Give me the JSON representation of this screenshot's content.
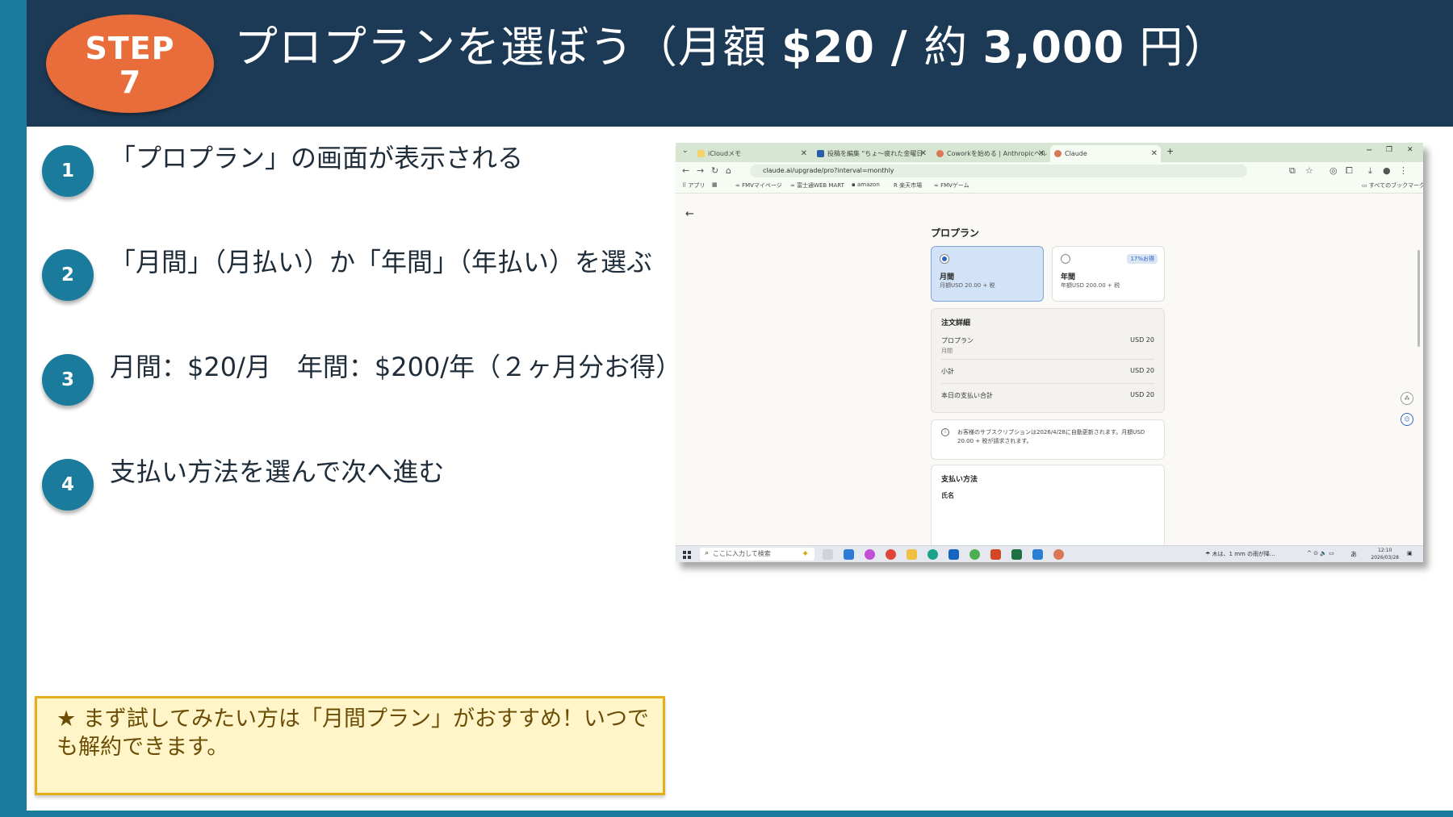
{
  "header": {
    "step_label": "STEP",
    "step_number": "7",
    "title_prefix": "プロプランを選ぼう（月額 ",
    "title_price_usd": "$20 / ",
    "title_approx": "約",
    "title_price_jpy": "3,000",
    "title_suffix": "円）"
  },
  "steps": [
    {
      "number": "1",
      "text": "「プロプラン」の画面が表示される"
    },
    {
      "number": "2",
      "text": "「月間」（月払い）か「年間」（年払い）を選ぶ"
    },
    {
      "number": "3",
      "text": "月間：$20/月　年間：$200/年（２ヶ月分お得）"
    },
    {
      "number": "4",
      "text": "支払い方法を選んで次へ進む"
    }
  ],
  "tip": {
    "text": "★ まず試してみたい方は「月間プラン」がおすすめ！いつでも解約できます。"
  },
  "colors": {
    "header_bg": "#1c3a55",
    "accent_blue": "#1a7b9c",
    "step_badge": "#e86d3a",
    "tip_bg": "#fff5c8",
    "tip_border": "#e5ac1b"
  },
  "screenshot": {
    "tabs": [
      {
        "label": "iCloudメモ",
        "icon": "note-icon"
      },
      {
        "label": "投稿を編集 \"ちょ〜疲れた金曜日",
        "icon": "blog-icon"
      },
      {
        "label": "Coworkを始める | Anthropicヘル",
        "icon": "anthropic-icon"
      },
      {
        "label": "Claude",
        "icon": "claude-icon"
      }
    ],
    "new_tab": "+",
    "window_controls": {
      "minimize": "−",
      "restore": "❐",
      "close": "✕"
    },
    "url": "claude.ai/upgrade/pro?interval=monthly",
    "bookmarks": {
      "apps": "アプリ",
      "items": [
        "FMVマイページ",
        "富士通WEB MART",
        "amazon",
        "楽天市場",
        "FMVゲーム"
      ],
      "all": "すべてのブックマーク"
    },
    "page": {
      "back": "←",
      "title": "プロプラン",
      "plans": [
        {
          "name": "月間",
          "price": "月額USD 20.00 + 税",
          "selected": true
        },
        {
          "name": "年間",
          "price": "年額USD 200.00 + 税",
          "selected": false,
          "badge": "17%お得"
        }
      ],
      "order": {
        "title": "注文詳細",
        "item_label": "プロプラン",
        "item_sub": "月間",
        "item_value": "USD 20",
        "subtotal_label": "小計",
        "subtotal_value": "USD 20",
        "total_label": "本日の支払い合計",
        "total_value": "USD 20"
      },
      "notice": "お客様のサブスクリプションは2026/4/28に自動更新されます。月額USD 20.00 + 税が請求されます。",
      "payment": {
        "title": "支払い方法",
        "name_label": "氏名"
      }
    },
    "taskbar": {
      "search_placeholder": "ここに入力して検索",
      "weather": "木は、1 mm の雨が降...",
      "ime": "あ",
      "time": "12:10",
      "date": "2026/03/28"
    }
  }
}
